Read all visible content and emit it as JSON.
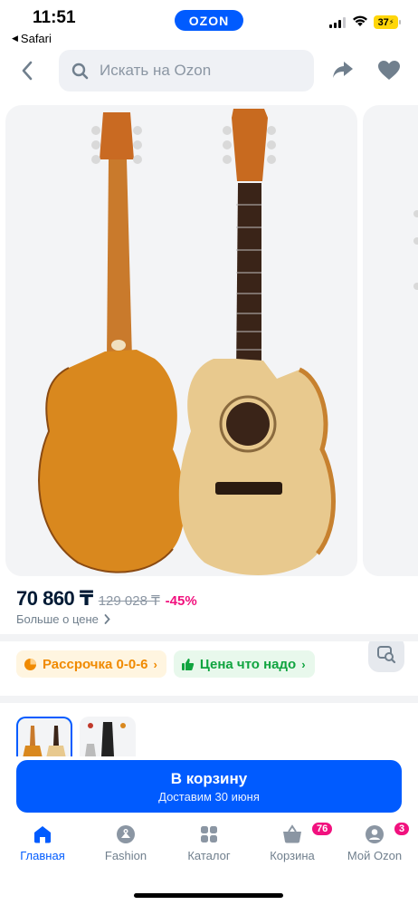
{
  "status_bar": {
    "time": "11:51",
    "back_app": "Safari",
    "brand": "OZON",
    "battery": "37"
  },
  "header": {
    "search_placeholder": "Искать на Ozon"
  },
  "price": {
    "current": "70 860 ₸",
    "old": "129 028 ₸",
    "discount": "-45%",
    "more": "Больше о цене"
  },
  "chips": [
    {
      "label": "Рассрочка 0-0-6",
      "color": "#f08a00"
    },
    {
      "label": "Цена что надо",
      "color": "#10a43f"
    }
  ],
  "cart": {
    "label": "В корзину",
    "delivery": "Доставим 30 июня"
  },
  "tabbar": {
    "items": [
      {
        "label": "Главная",
        "icon": "home-icon",
        "active": true
      },
      {
        "label": "Fashion",
        "icon": "fashion-icon"
      },
      {
        "label": "Каталог",
        "icon": "catalog-icon"
      },
      {
        "label": "Корзина",
        "icon": "basket-icon",
        "badge": "76"
      },
      {
        "label": "Мой Ozon",
        "icon": "profile-icon",
        "badge": "3"
      }
    ]
  },
  "colors": {
    "brand": "#005bff",
    "discount": "#f1117e"
  }
}
